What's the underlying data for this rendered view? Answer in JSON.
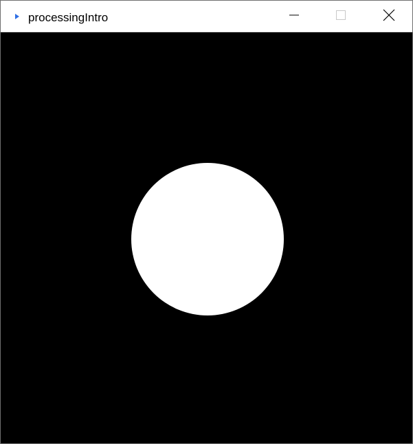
{
  "window": {
    "title": "processingIntro",
    "icon": "processing-play-icon",
    "accent_color": "#2f6fe4",
    "buttons": {
      "minimize_icon": "minimize-icon",
      "maximize_icon": "maximize-icon",
      "close_icon": "close-icon"
    }
  },
  "sketch": {
    "background_color": "#000000",
    "shape": "circle",
    "fill_color": "#ffffff"
  }
}
